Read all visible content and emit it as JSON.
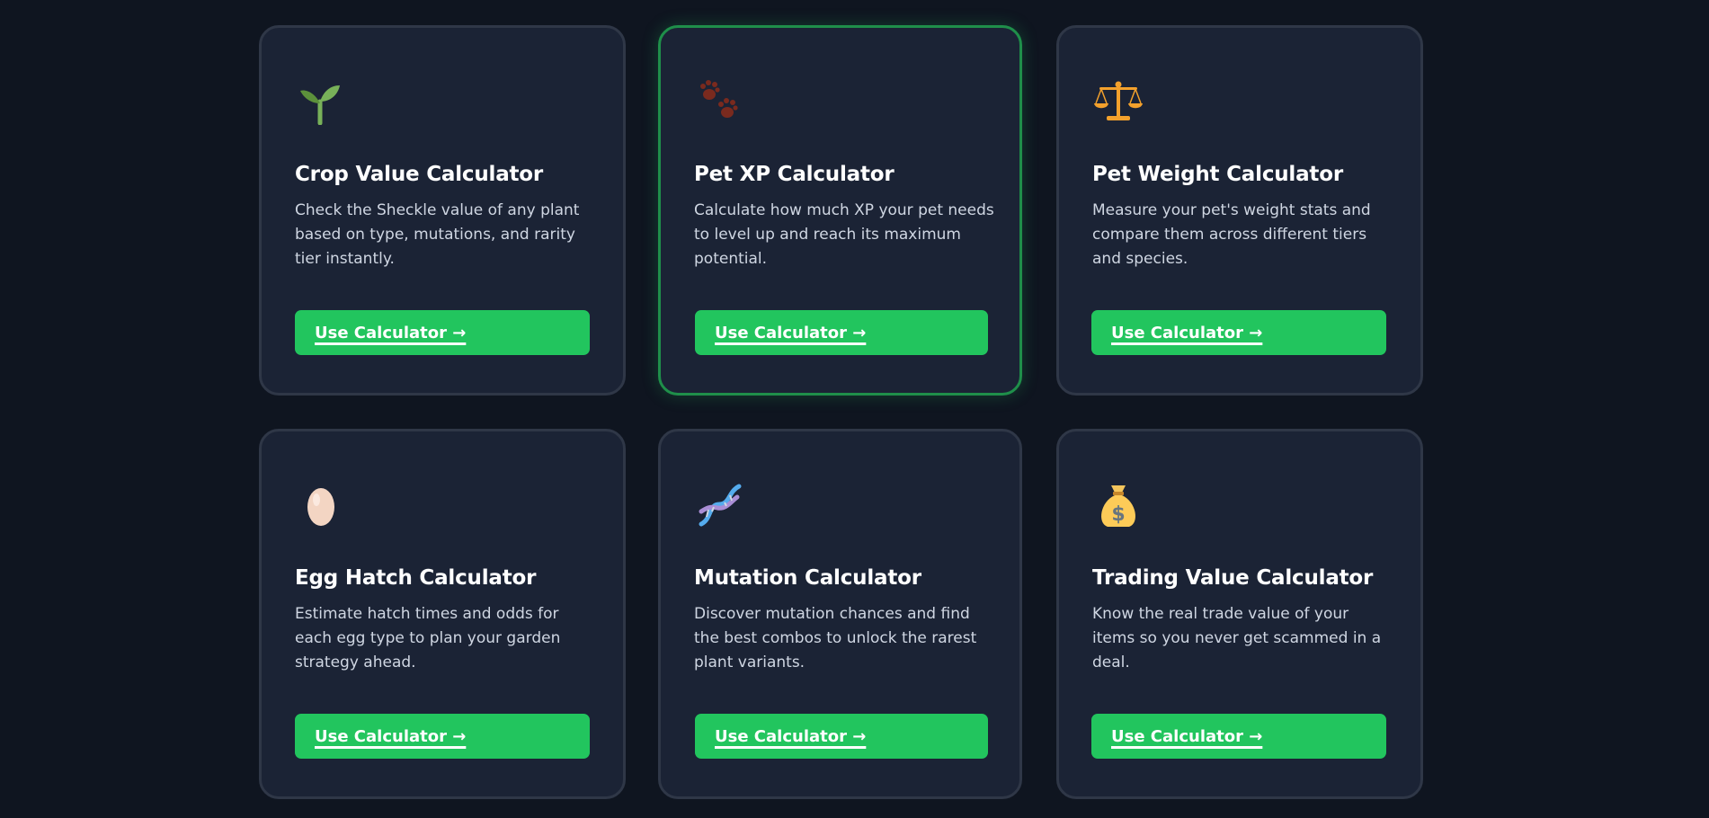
{
  "cards": [
    {
      "title": "Crop Value Calculator",
      "description": "Check the Sheckle value of any plant based on type, mutations, and rarity tier instantly.",
      "button_label": "Use Calculator →",
      "icon": "seedling-icon"
    },
    {
      "title": "Pet XP Calculator",
      "description": "Calculate how much XP your pet needs to level up and reach its maximum potential.",
      "button_label": "Use Calculator →",
      "icon": "paw-prints-icon"
    },
    {
      "title": "Pet Weight Calculator",
      "description": "Measure your pet's weight stats and compare them across different tiers and species.",
      "button_label": "Use Calculator →",
      "icon": "balance-scale-icon"
    },
    {
      "title": "Egg Hatch Calculator",
      "description": "Estimate hatch times and odds for each egg type to plan your garden strategy ahead.",
      "button_label": "Use Calculator →",
      "icon": "egg-icon"
    },
    {
      "title": "Mutation Calculator",
      "description": "Discover mutation chances and find the best combos to unlock the rarest plant variants.",
      "button_label": "Use Calculator →",
      "icon": "dna-icon"
    },
    {
      "title": "Trading Value Calculator",
      "description": "Know the real trade value of your items so you never get scammed in a deal.",
      "button_label": "Use Calculator →",
      "icon": "money-bag-icon"
    }
  ],
  "colors": {
    "background": "#0f1520",
    "card": "#1b2335",
    "card_border": "#2f3747",
    "active_border": "#1f8f4a",
    "button": "#22c55e"
  }
}
